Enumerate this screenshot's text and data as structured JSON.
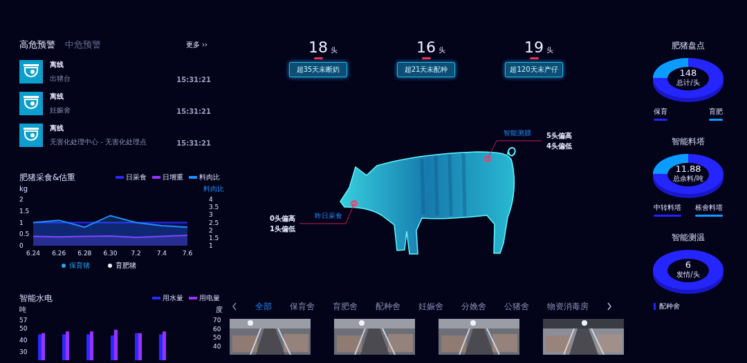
{
  "alerts": {
    "tabs": [
      {
        "label": "高危预警",
        "selected": true
      },
      {
        "label": "中危预警",
        "selected": false
      }
    ],
    "more": "更多 ››",
    "items": [
      {
        "status": "离线",
        "location": "出猪台",
        "time": "15:31:21"
      },
      {
        "status": "离线",
        "location": "妊娠舍",
        "time": "15:31:21"
      },
      {
        "status": "离线",
        "location": "无害化处理中心 - 无害化处理点",
        "time": "15:31:21"
      }
    ]
  },
  "feed_chart": {
    "chart_data": {
      "type": "area",
      "title": "肥猪采食&估重",
      "ylabel": "kg",
      "y2label": "料肉比",
      "categories": [
        "6.24",
        "6.26",
        "6.28",
        "6.30",
        "7.2",
        "7.4",
        "7.6"
      ],
      "ylim": [
        0,
        2
      ],
      "y2lim": [
        1,
        4
      ],
      "yticks": [
        0,
        0.5,
        1,
        1.5,
        2
      ],
      "y2ticks": [
        1,
        1.5,
        2,
        2.5,
        3,
        3.5,
        4
      ],
      "series": [
        {
          "name": "日采食",
          "color": "#2a2aff",
          "values": [
            1,
            1,
            1,
            1,
            1,
            1,
            1
          ]
        },
        {
          "name": "日增重",
          "color": "#9933ff",
          "values": [
            0.4,
            0.38,
            0.4,
            0.42,
            0.36,
            0.4,
            0.45
          ]
        },
        {
          "name": "料肉比",
          "color": "#1e90ff",
          "axis": "y2",
          "values": [
            2.5,
            2.65,
            2.2,
            2.95,
            2.5,
            2.3,
            2.2
          ]
        }
      ]
    },
    "filters": [
      {
        "label": "保育猪",
        "selected": true
      },
      {
        "label": "育肥猪",
        "selected": false
      }
    ]
  },
  "utility_chart": {
    "chart_data": {
      "type": "bar",
      "title": "智能水电",
      "ylabel": "吨",
      "y2label": "度",
      "categories": [
        null,
        null,
        null,
        null,
        null,
        null
      ],
      "ylim": [
        30,
        57
      ],
      "y2lim": [
        40,
        70
      ],
      "yticks": [
        30,
        40,
        50,
        57
      ],
      "y2ticks": [
        40,
        50,
        60,
        70
      ],
      "series": [
        {
          "name": "用水量",
          "color": "#2a2aff",
          "values": [
            45,
            45,
            45,
            44,
            46,
            45
          ]
        },
        {
          "name": "用电量",
          "color": "#9933ff",
          "axis": "y2",
          "values": [
            55,
            57,
            57,
            59,
            55,
            57
          ]
        }
      ]
    }
  },
  "stats": [
    {
      "count": "18",
      "unit": "头",
      "label": "超35天未断奶"
    },
    {
      "count": "16",
      "unit": "头",
      "label": "超21天未配种"
    },
    {
      "count": "19",
      "unit": "头",
      "label": "超120天未产仔"
    }
  ],
  "annotations": [
    {
      "title": "智能测膘",
      "lines": [
        "5头偏高",
        "4头偏低"
      ]
    },
    {
      "title": "昨日采食",
      "lines": [
        "0头偏高",
        "1头偏低"
      ]
    }
  ],
  "house_tabs": [
    {
      "label": "全部",
      "selected": true
    },
    {
      "label": "保育舍",
      "selected": false
    },
    {
      "label": "育肥舍",
      "selected": false
    },
    {
      "label": "配种舍",
      "selected": false
    },
    {
      "label": "妊娠舍",
      "selected": false
    },
    {
      "label": "分娩舍",
      "selected": false
    },
    {
      "label": "公猪舍",
      "selected": false
    },
    {
      "label": "物资消毒房",
      "selected": false
    }
  ],
  "summaries": [
    {
      "title": "肥猪盘点",
      "value": "148",
      "caption": "总计/头",
      "legend": [
        {
          "label": "保育",
          "color": "#2323ff"
        },
        {
          "label": "育肥",
          "color": "#0a9cff"
        }
      ]
    },
    {
      "title": "智能料塔",
      "value": "11.88",
      "caption": "总余料/吨",
      "legend": [
        {
          "label": "中转料塔",
          "color": "#2323ff"
        },
        {
          "label": "栋舍料塔",
          "color": "#0a9cff"
        }
      ]
    },
    {
      "title": "智能测温",
      "value": "6",
      "caption": "发情/头",
      "legend": [
        {
          "label": "配种舍",
          "color": "#2323ff"
        }
      ]
    }
  ]
}
